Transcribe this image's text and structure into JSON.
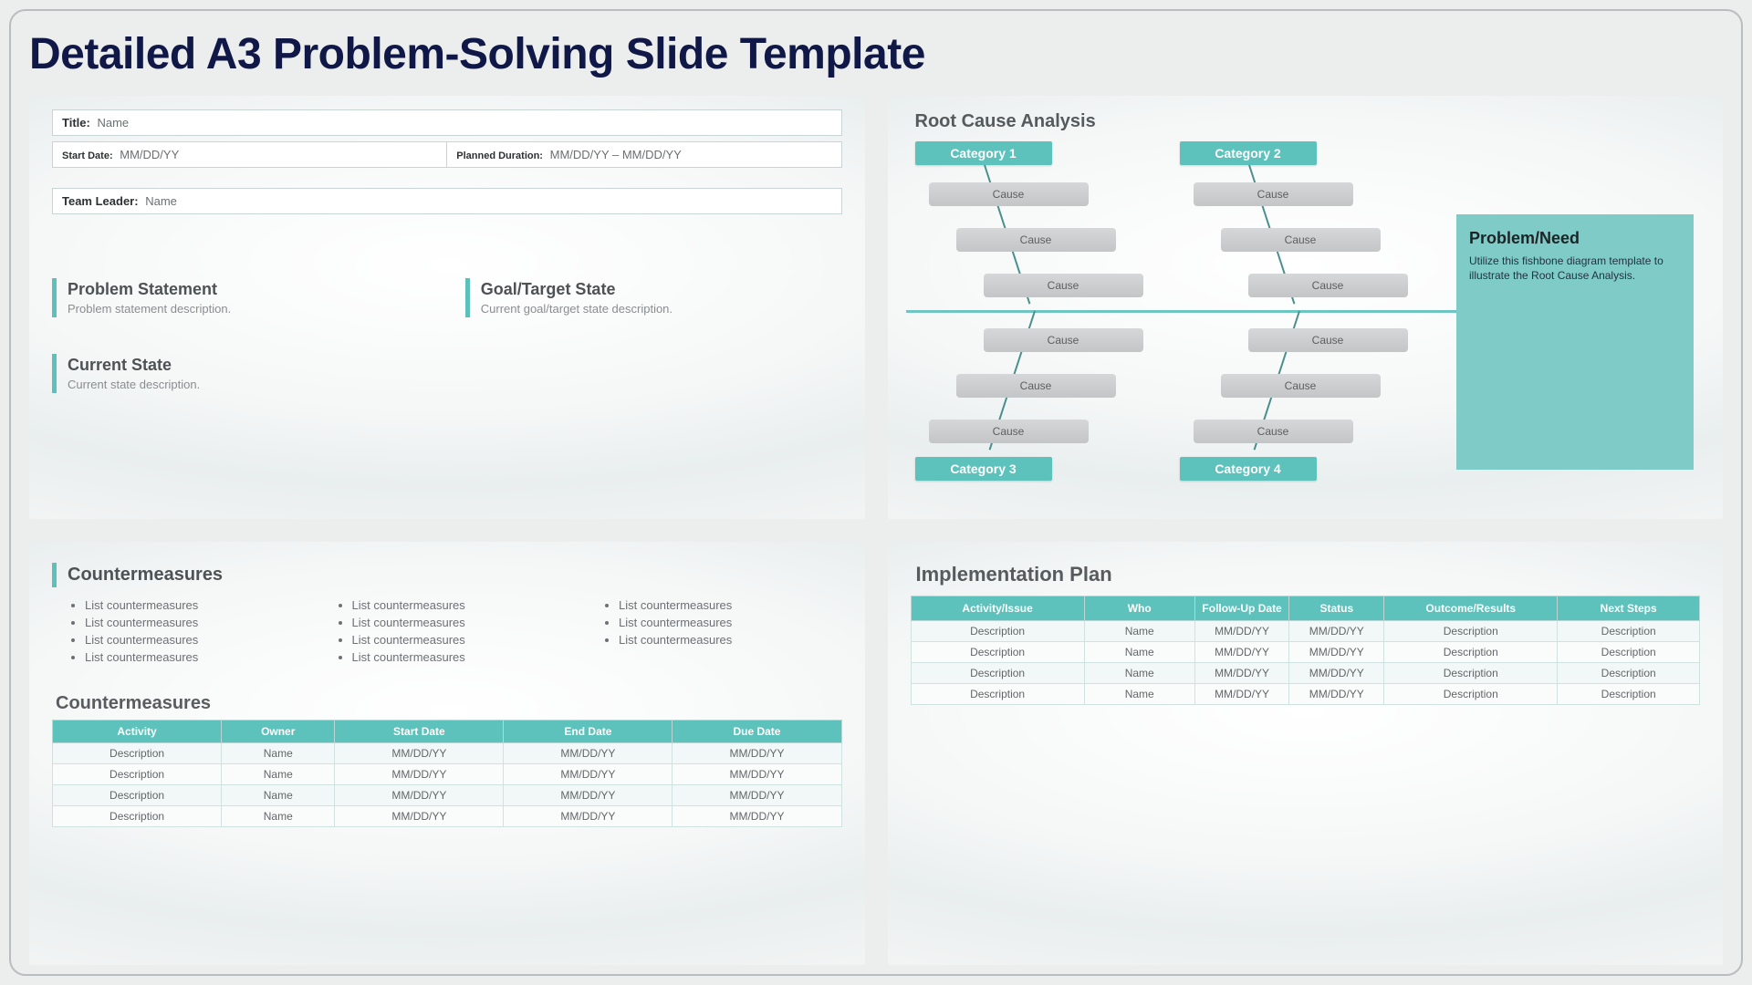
{
  "title": "Detailed A3 Problem-Solving Slide Template",
  "header": {
    "title_label": "Title:",
    "title_value": "Name",
    "start_label": "Start Date:",
    "start_value": "MM/DD/YY",
    "duration_label": "Planned Duration:",
    "duration_value": "MM/DD/YY – MM/DD/YY",
    "leader_label": "Team Leader:",
    "leader_value": "Name"
  },
  "sections": {
    "problem": {
      "h": "Problem Statement",
      "p": "Problem statement description."
    },
    "goal": {
      "h": "Goal/Target State",
      "p": "Current goal/target state description."
    },
    "current": {
      "h": "Current State",
      "p": "Current state description."
    }
  },
  "rca": {
    "title": "Root Cause Analysis",
    "problem_h": "Problem/Need",
    "problem_p": "Utilize this fishbone diagram template to illustrate the Root Cause Analysis.",
    "cats": [
      "Category 1",
      "Category 2",
      "Category 3",
      "Category 4"
    ],
    "cause": "Cause"
  },
  "cm": {
    "title": "Countermeasures",
    "sub": "Countermeasures",
    "item": "List countermeasures",
    "tbl_h": [
      "Activity",
      "Owner",
      "Start Date",
      "End Date",
      "Due Date"
    ],
    "row": {
      "desc": "Description",
      "owner": "Name",
      "d": "MM/DD/YY"
    }
  },
  "impl": {
    "title": "Implementation Plan",
    "tbl_h": [
      "Activity/Issue",
      "Who",
      "Follow-Up Date",
      "Status",
      "Outcome/Results",
      "Next Steps"
    ],
    "row": {
      "desc": "Description",
      "who": "Name",
      "d": "MM/DD/YY"
    }
  }
}
